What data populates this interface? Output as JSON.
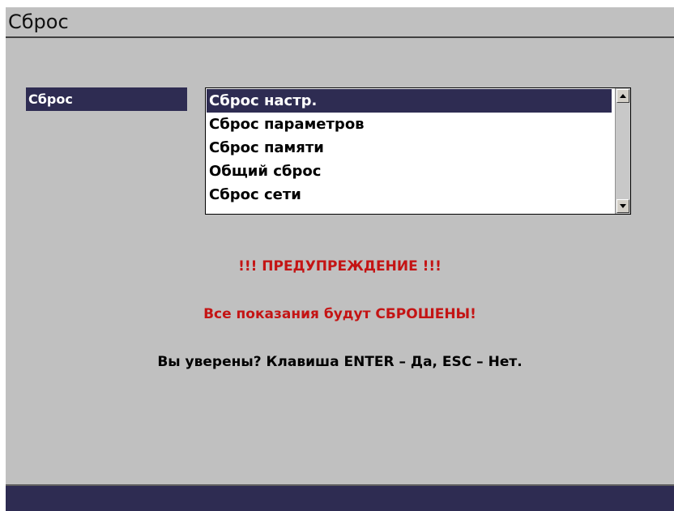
{
  "window": {
    "title": "Сброс"
  },
  "reset_field": {
    "label": "Сброс",
    "options": [
      "Сброс настр.",
      "Сброс параметров",
      "Сброс памяти",
      "Общий сброс",
      "Сброс сети"
    ],
    "selected_index": 0
  },
  "warning": {
    "heading": "!!! ПРЕДУПРЕЖДЕНИЕ !!!",
    "message": "Все показания будут СБРОШЕНЫ!",
    "confirm": "Вы уверены? Клавиша ENTER – Да, ESC – Нет."
  },
  "colors": {
    "background": "#c0c0c0",
    "selection": "#2e2c52",
    "warning": "#c41414"
  },
  "icons": {
    "scroll_up": "arrow-up-icon",
    "scroll_down": "arrow-down-icon"
  }
}
